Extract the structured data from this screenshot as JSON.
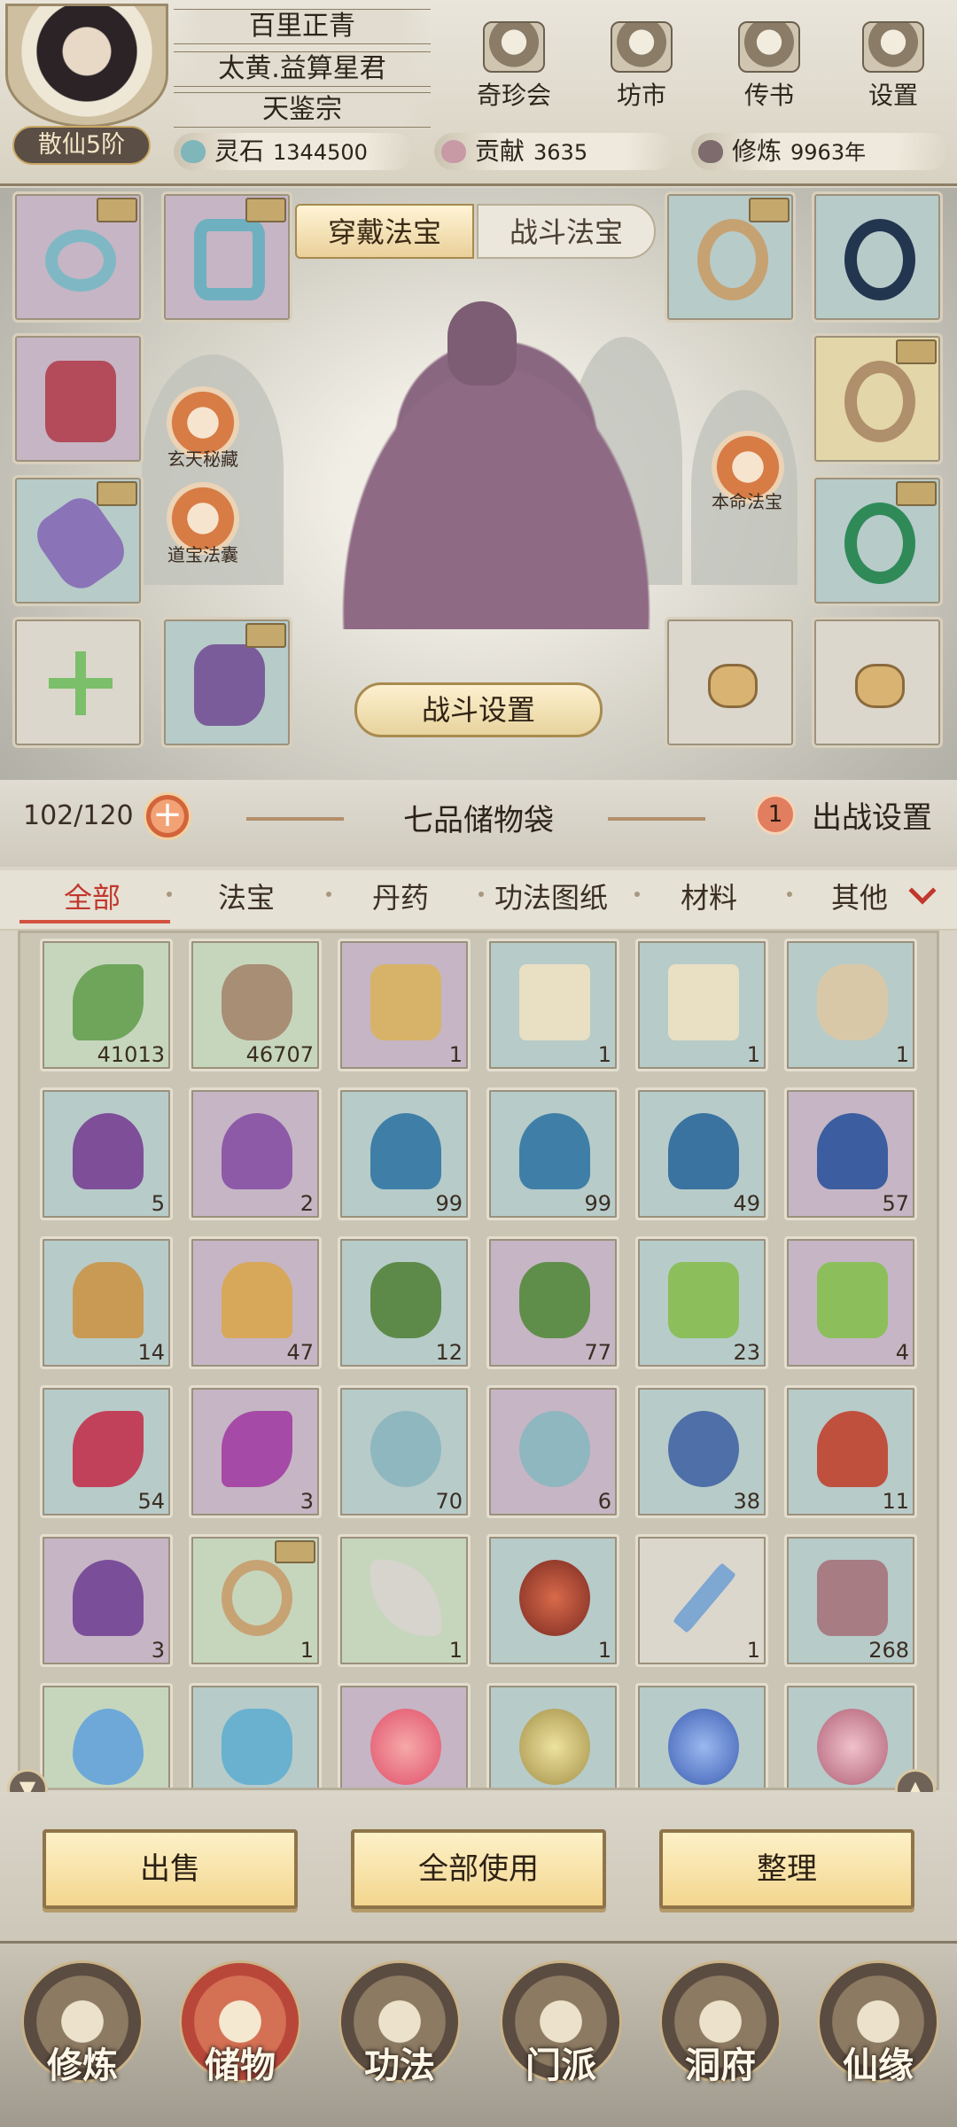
{
  "player": {
    "name": "百里正青",
    "title": "太黄.益算星君",
    "sect": "天鉴宗",
    "rank": "散仙5阶"
  },
  "top_menu": [
    "奇珍会",
    "坊市",
    "传书",
    "设置"
  ],
  "resources": {
    "spirit_stone_label": "灵石",
    "spirit_stone": "1344500",
    "contribution_label": "贡献",
    "contribution": "3635",
    "cultivation_label": "修炼",
    "cultivation": "9963年"
  },
  "equip": {
    "tab_wear": "穿戴法宝",
    "tab_battle": "战斗法宝",
    "left_buttons": [
      "玄天秘藏",
      "道宝法囊"
    ],
    "right_button": "本命法宝",
    "fight_settings": "战斗设置"
  },
  "bag": {
    "capacity": "102/120",
    "title": "七品储物袋",
    "deploy_count": "1",
    "deploy_label": "出战设置"
  },
  "categories": [
    "全部",
    "法宝",
    "丹药",
    "功法图纸",
    "材料",
    "其他"
  ],
  "inventory": [
    [
      "41013",
      "46707",
      "1",
      "1",
      "1",
      "1"
    ],
    [
      "5",
      "2",
      "99",
      "99",
      "49",
      "57"
    ],
    [
      "14",
      "47",
      "12",
      "77",
      "23",
      "4"
    ],
    [
      "54",
      "3",
      "70",
      "6",
      "38",
      "11"
    ],
    [
      "3",
      "1",
      "1",
      "1",
      "1",
      "268"
    ],
    [
      "",
      "",
      "",
      "",
      "",
      ""
    ]
  ],
  "actions": [
    "出售",
    "全部使用",
    "整理"
  ],
  "nav": [
    "修炼",
    "储物",
    "功法",
    "门派",
    "洞府",
    "仙缘"
  ],
  "colors": {
    "accent": "#c1372d",
    "gold_button": "#f3d68e"
  }
}
